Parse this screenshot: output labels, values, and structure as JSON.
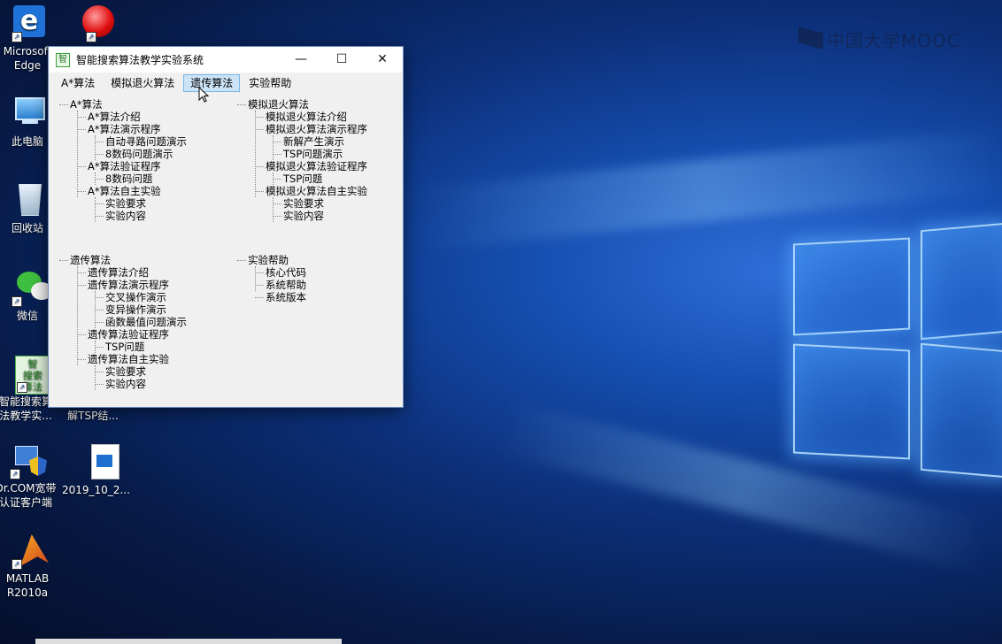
{
  "watermark": "中国大学MOOC",
  "desktop_icons": [
    {
      "name": "edge",
      "label": "Microsoft Edge"
    },
    {
      "name": "red-app",
      "label": ""
    },
    {
      "name": "this-pc",
      "label": "此电脑"
    },
    {
      "name": "recycle-bin",
      "label": "回收站"
    },
    {
      "name": "wechat",
      "label": "微信"
    },
    {
      "name": "smart-search",
      "label": "智能搜索算法教学实...",
      "icon_text": "智\n搜索\n算法"
    },
    {
      "name": "ga-tsp",
      "label": "遗传算法求解TSP结..."
    },
    {
      "name": "drcom",
      "label": "Dr.COM宽带认证客户端"
    },
    {
      "name": "video-file",
      "label": "2019_10_2..."
    },
    {
      "name": "matlab",
      "label": "MATLAB R2010a"
    }
  ],
  "window": {
    "title": "智能搜索算法教学实验系统",
    "app_icon": "智",
    "buttons": {
      "minimize": "—",
      "maximize": "☐",
      "close": "✕"
    },
    "menu": [
      "A*算法",
      "模拟退火算法",
      "遗传算法",
      "实验帮助"
    ],
    "active_menu": "遗传算法",
    "trees": {
      "astar": [
        {
          "level": 0,
          "text": "A*算法"
        },
        {
          "level": 1,
          "text": "A*算法介绍"
        },
        {
          "level": 1,
          "text": "A*算法演示程序"
        },
        {
          "level": 2,
          "text": "自动寻路问题演示"
        },
        {
          "level": 2,
          "text": "8数码问题演示"
        },
        {
          "level": 1,
          "text": "A*算法验证程序"
        },
        {
          "level": 2,
          "text": "8数码问题"
        },
        {
          "level": 1,
          "text": "A*算法自主实验"
        },
        {
          "level": 2,
          "text": "实验要求"
        },
        {
          "level": 2,
          "text": "实验内容"
        }
      ],
      "sa": [
        {
          "level": 0,
          "text": "模拟退火算法"
        },
        {
          "level": 1,
          "text": "模拟退火算法介绍"
        },
        {
          "level": 1,
          "text": "模拟退火算法演示程序"
        },
        {
          "level": 2,
          "text": "新解产生演示"
        },
        {
          "level": 2,
          "text": "TSP问题演示"
        },
        {
          "level": 1,
          "text": "模拟退火算法验证程序"
        },
        {
          "level": 2,
          "text": "TSP问题"
        },
        {
          "level": 1,
          "text": "模拟退火算法自主实验"
        },
        {
          "level": 2,
          "text": "实验要求"
        },
        {
          "level": 2,
          "text": "实验内容"
        }
      ],
      "ga": [
        {
          "level": 0,
          "text": "遗传算法"
        },
        {
          "level": 1,
          "text": "遗传算法介绍"
        },
        {
          "level": 1,
          "text": "遗传算法演示程序"
        },
        {
          "level": 2,
          "text": "交叉操作演示"
        },
        {
          "level": 2,
          "text": "变异操作演示"
        },
        {
          "level": 2,
          "text": "函数最值问题演示"
        },
        {
          "level": 1,
          "text": "遗传算法验证程序"
        },
        {
          "level": 2,
          "text": "TSP问题"
        },
        {
          "level": 1,
          "text": "遗传算法自主实验"
        },
        {
          "level": 2,
          "text": "实验要求"
        },
        {
          "level": 2,
          "text": "实验内容"
        }
      ],
      "help": [
        {
          "level": 0,
          "text": "实验帮助"
        },
        {
          "level": 1,
          "text": "核心代码"
        },
        {
          "level": 1,
          "text": "系统帮助"
        },
        {
          "level": 1,
          "text": "系统版本"
        }
      ]
    }
  },
  "colors": {
    "menu_active_bg": "#cce4f7",
    "menu_active_border": "#7ab4e6",
    "window_bg": "#f0f0f0"
  }
}
